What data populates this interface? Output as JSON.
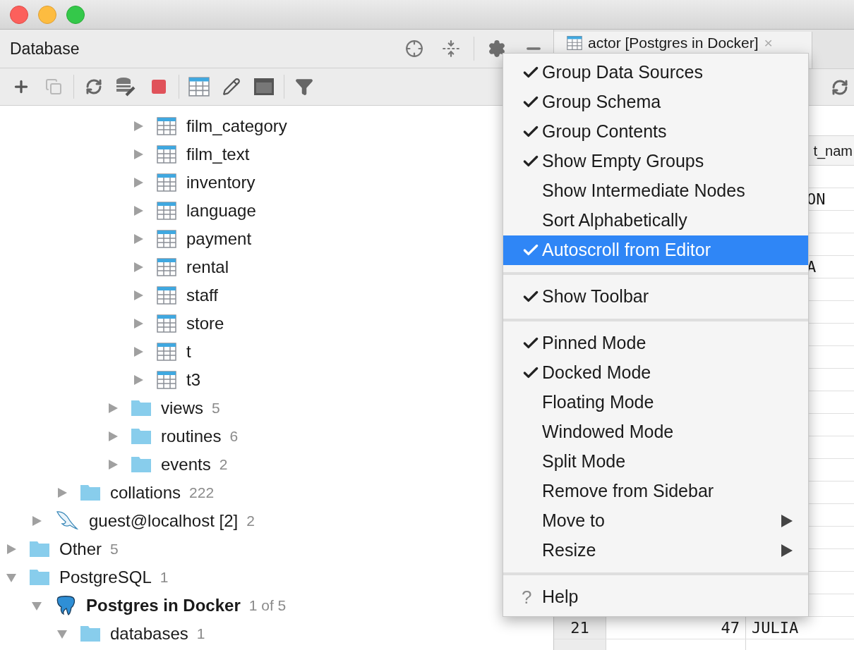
{
  "panel": {
    "title": "Database"
  },
  "tree": [
    {
      "children": [
        {
          "children": [
            {
              "children": [
                {
                  "children": [
                    {
                      "children": [
                        {
                          "label": "film_category",
                          "kind": "table",
                          "expanded": false
                        },
                        {
                          "label": "film_text",
                          "kind": "table",
                          "expanded": false
                        },
                        {
                          "label": "inventory",
                          "kind": "table",
                          "expanded": false
                        },
                        {
                          "label": "language",
                          "kind": "table",
                          "expanded": false
                        },
                        {
                          "label": "payment",
                          "kind": "table",
                          "expanded": false
                        },
                        {
                          "label": "rental",
                          "kind": "table",
                          "expanded": false
                        },
                        {
                          "label": "staff",
                          "kind": "table",
                          "expanded": false
                        },
                        {
                          "label": "store",
                          "kind": "table",
                          "expanded": false
                        },
                        {
                          "label": "t",
                          "kind": "table",
                          "expanded": false
                        },
                        {
                          "label": "t3",
                          "kind": "table",
                          "expanded": false
                        }
                      ]
                    },
                    {
                      "label": "views",
                      "count": "5",
                      "kind": "folder",
                      "expanded": false
                    },
                    {
                      "label": "routines",
                      "count": "6",
                      "kind": "folder",
                      "expanded": false
                    },
                    {
                      "label": "events",
                      "count": "2",
                      "kind": "folder",
                      "expanded": false
                    }
                  ]
                }
              ]
            },
            {
              "label": "collations",
              "count": "222",
              "kind": "folder",
              "expanded": false
            }
          ]
        },
        {
          "label": "guest@localhost [2]",
          "count": "2",
          "kind": "mysql",
          "expanded": false,
          "active": false
        }
      ]
    },
    {
      "label": "Other",
      "count": "5",
      "kind": "folder",
      "expanded": false
    },
    {
      "label": "PostgreSQL",
      "count": "1",
      "kind": "folder",
      "expanded": true,
      "children": [
        {
          "label": "Postgres in Docker",
          "count": "1 of 5",
          "kind": "postgres",
          "expanded": true,
          "active": true,
          "children": [
            {
              "label": "databases",
              "count": "1",
              "kind": "folder",
              "expanded": true
            }
          ]
        }
      ]
    }
  ],
  "editor": {
    "tab": {
      "title": "actor [Postgres in Docker]",
      "close": "×"
    },
    "table": {
      "header": "t_nam",
      "rows": [
        {},
        {
          "name": "ON"
        },
        {},
        {},
        {
          "name": "A"
        },
        {},
        {},
        {},
        {},
        {},
        {},
        {},
        {},
        {},
        {},
        {},
        {},
        {},
        {},
        {},
        {
          "row": "21",
          "id": "47",
          "name": "JULIA"
        },
        {}
      ]
    }
  },
  "menu": [
    {
      "kind": "item",
      "label": "Group Data Sources",
      "checked": true,
      "selected": false
    },
    {
      "kind": "item",
      "label": "Group Schema",
      "checked": true,
      "selected": false
    },
    {
      "kind": "item",
      "label": "Group Contents",
      "checked": true,
      "selected": false
    },
    {
      "kind": "item",
      "label": "Show Empty Groups",
      "checked": true,
      "selected": false
    },
    {
      "kind": "item",
      "label": "Show Intermediate Nodes",
      "checked": false,
      "selected": false
    },
    {
      "kind": "item",
      "label": "Sort Alphabetically",
      "checked": false,
      "selected": false
    },
    {
      "kind": "item",
      "label": "Autoscroll from Editor",
      "checked": true,
      "selected": true
    },
    {
      "kind": "separator"
    },
    {
      "kind": "item",
      "label": "Show Toolbar",
      "checked": true,
      "selected": false
    },
    {
      "kind": "separator"
    },
    {
      "kind": "item",
      "label": "Pinned Mode",
      "checked": true,
      "selected": false
    },
    {
      "kind": "item",
      "label": "Docked Mode",
      "checked": true,
      "selected": false
    },
    {
      "kind": "item",
      "label": "Floating Mode",
      "checked": false,
      "selected": false
    },
    {
      "kind": "item",
      "label": "Windowed Mode",
      "checked": false,
      "selected": false
    },
    {
      "kind": "item",
      "label": "Split Mode",
      "checked": false,
      "selected": false
    },
    {
      "kind": "item",
      "label": "Remove from Sidebar",
      "checked": false,
      "selected": false
    },
    {
      "kind": "submenu",
      "label": "Move to",
      "selected": false
    },
    {
      "kind": "submenu",
      "label": "Resize",
      "selected": false
    },
    {
      "kind": "separator"
    },
    {
      "kind": "help",
      "icon": "?",
      "label": "Help",
      "selected": false
    }
  ]
}
